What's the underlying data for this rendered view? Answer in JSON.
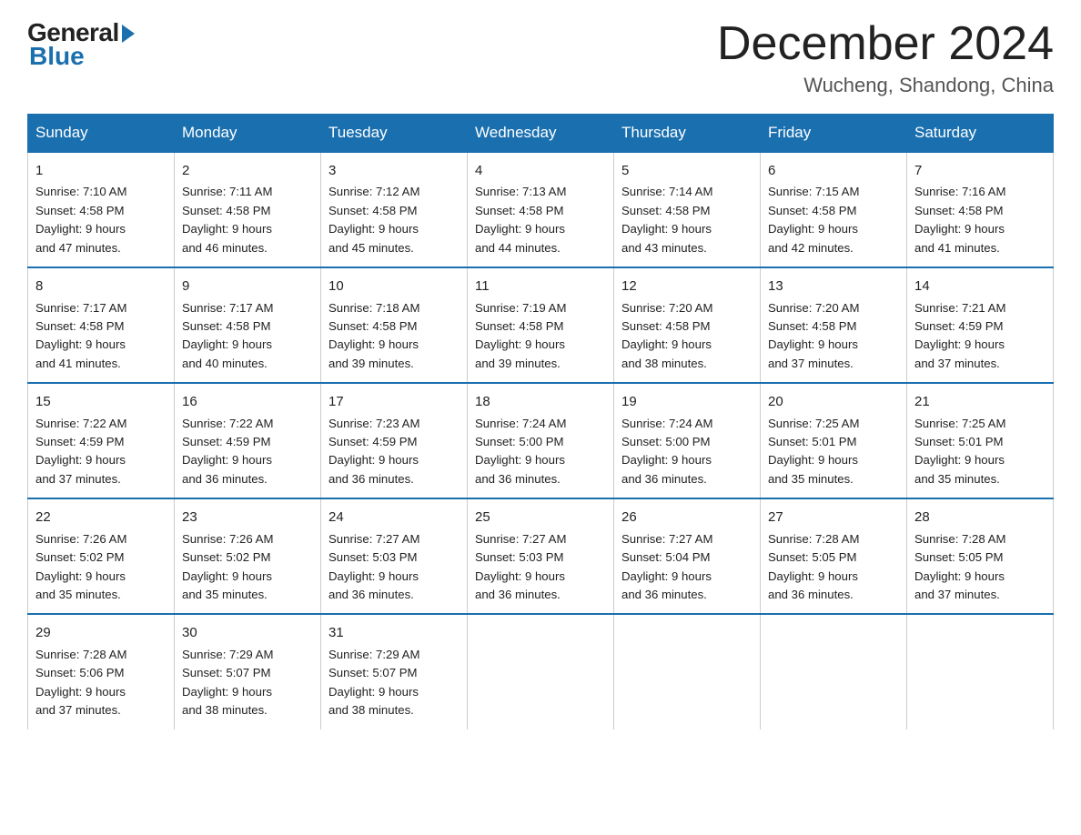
{
  "logo": {
    "general": "General",
    "blue": "Blue"
  },
  "header": {
    "month_year": "December 2024",
    "location": "Wucheng, Shandong, China"
  },
  "days_of_week": [
    "Sunday",
    "Monday",
    "Tuesday",
    "Wednesday",
    "Thursday",
    "Friday",
    "Saturday"
  ],
  "weeks": [
    [
      {
        "day": "1",
        "sunrise": "7:10 AM",
        "sunset": "4:58 PM",
        "daylight": "9 hours and 47 minutes."
      },
      {
        "day": "2",
        "sunrise": "7:11 AM",
        "sunset": "4:58 PM",
        "daylight": "9 hours and 46 minutes."
      },
      {
        "day": "3",
        "sunrise": "7:12 AM",
        "sunset": "4:58 PM",
        "daylight": "9 hours and 45 minutes."
      },
      {
        "day": "4",
        "sunrise": "7:13 AM",
        "sunset": "4:58 PM",
        "daylight": "9 hours and 44 minutes."
      },
      {
        "day": "5",
        "sunrise": "7:14 AM",
        "sunset": "4:58 PM",
        "daylight": "9 hours and 43 minutes."
      },
      {
        "day": "6",
        "sunrise": "7:15 AM",
        "sunset": "4:58 PM",
        "daylight": "9 hours and 42 minutes."
      },
      {
        "day": "7",
        "sunrise": "7:16 AM",
        "sunset": "4:58 PM",
        "daylight": "9 hours and 41 minutes."
      }
    ],
    [
      {
        "day": "8",
        "sunrise": "7:17 AM",
        "sunset": "4:58 PM",
        "daylight": "9 hours and 41 minutes."
      },
      {
        "day": "9",
        "sunrise": "7:17 AM",
        "sunset": "4:58 PM",
        "daylight": "9 hours and 40 minutes."
      },
      {
        "day": "10",
        "sunrise": "7:18 AM",
        "sunset": "4:58 PM",
        "daylight": "9 hours and 39 minutes."
      },
      {
        "day": "11",
        "sunrise": "7:19 AM",
        "sunset": "4:58 PM",
        "daylight": "9 hours and 39 minutes."
      },
      {
        "day": "12",
        "sunrise": "7:20 AM",
        "sunset": "4:58 PM",
        "daylight": "9 hours and 38 minutes."
      },
      {
        "day": "13",
        "sunrise": "7:20 AM",
        "sunset": "4:58 PM",
        "daylight": "9 hours and 37 minutes."
      },
      {
        "day": "14",
        "sunrise": "7:21 AM",
        "sunset": "4:59 PM",
        "daylight": "9 hours and 37 minutes."
      }
    ],
    [
      {
        "day": "15",
        "sunrise": "7:22 AM",
        "sunset": "4:59 PM",
        "daylight": "9 hours and 37 minutes."
      },
      {
        "day": "16",
        "sunrise": "7:22 AM",
        "sunset": "4:59 PM",
        "daylight": "9 hours and 36 minutes."
      },
      {
        "day": "17",
        "sunrise": "7:23 AM",
        "sunset": "4:59 PM",
        "daylight": "9 hours and 36 minutes."
      },
      {
        "day": "18",
        "sunrise": "7:24 AM",
        "sunset": "5:00 PM",
        "daylight": "9 hours and 36 minutes."
      },
      {
        "day": "19",
        "sunrise": "7:24 AM",
        "sunset": "5:00 PM",
        "daylight": "9 hours and 36 minutes."
      },
      {
        "day": "20",
        "sunrise": "7:25 AM",
        "sunset": "5:01 PM",
        "daylight": "9 hours and 35 minutes."
      },
      {
        "day": "21",
        "sunrise": "7:25 AM",
        "sunset": "5:01 PM",
        "daylight": "9 hours and 35 minutes."
      }
    ],
    [
      {
        "day": "22",
        "sunrise": "7:26 AM",
        "sunset": "5:02 PM",
        "daylight": "9 hours and 35 minutes."
      },
      {
        "day": "23",
        "sunrise": "7:26 AM",
        "sunset": "5:02 PM",
        "daylight": "9 hours and 35 minutes."
      },
      {
        "day": "24",
        "sunrise": "7:27 AM",
        "sunset": "5:03 PM",
        "daylight": "9 hours and 36 minutes."
      },
      {
        "day": "25",
        "sunrise": "7:27 AM",
        "sunset": "5:03 PM",
        "daylight": "9 hours and 36 minutes."
      },
      {
        "day": "26",
        "sunrise": "7:27 AM",
        "sunset": "5:04 PM",
        "daylight": "9 hours and 36 minutes."
      },
      {
        "day": "27",
        "sunrise": "7:28 AM",
        "sunset": "5:05 PM",
        "daylight": "9 hours and 36 minutes."
      },
      {
        "day": "28",
        "sunrise": "7:28 AM",
        "sunset": "5:05 PM",
        "daylight": "9 hours and 37 minutes."
      }
    ],
    [
      {
        "day": "29",
        "sunrise": "7:28 AM",
        "sunset": "5:06 PM",
        "daylight": "9 hours and 37 minutes."
      },
      {
        "day": "30",
        "sunrise": "7:29 AM",
        "sunset": "5:07 PM",
        "daylight": "9 hours and 38 minutes."
      },
      {
        "day": "31",
        "sunrise": "7:29 AM",
        "sunset": "5:07 PM",
        "daylight": "9 hours and 38 minutes."
      },
      null,
      null,
      null,
      null
    ]
  ],
  "sunrise_label": "Sunrise:",
  "sunset_label": "Sunset:",
  "daylight_label": "Daylight:"
}
